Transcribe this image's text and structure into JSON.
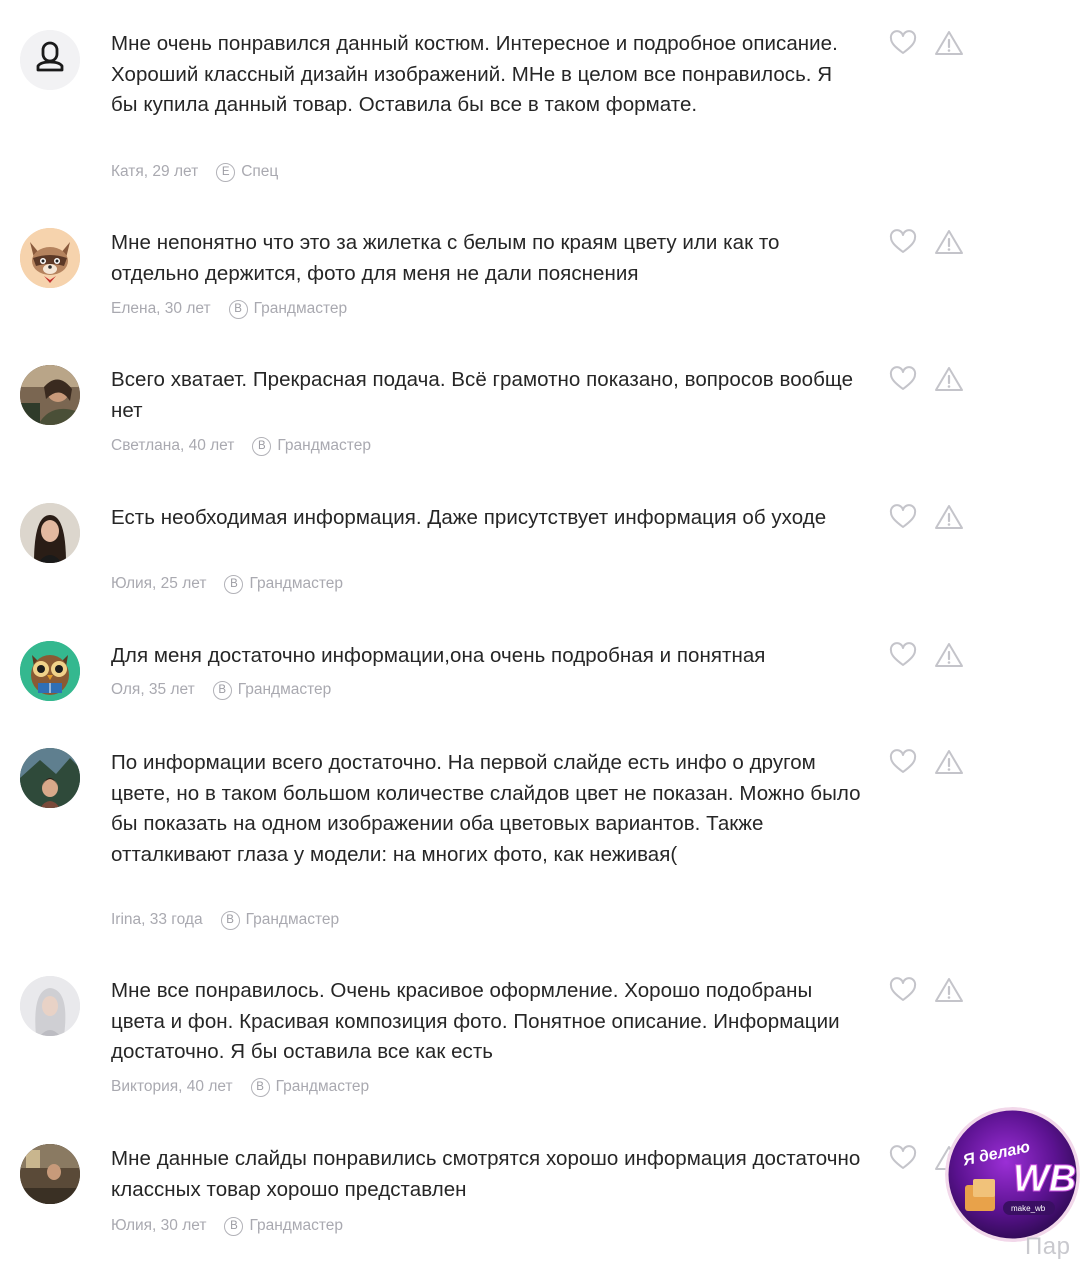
{
  "reviews": [
    {
      "text": "Мне очень понравился данный костюм. Интересное и подробное описание. Хороший классный дизайн изображений. МНе в целом все понравилось. Я бы купила данный товар. Оставила бы все в таком формате.",
      "author": "Катя, 29 лет",
      "level_letter": "E",
      "level": "Спец",
      "avatar_icon": "default-user-icon"
    },
    {
      "text": "Мне непонятно что это за жилетка с белым по краям цвету или как то отдельно держится, фото для меня не дали пояснения",
      "author": "Елена, 30 лет",
      "level_letter": "B",
      "level": "Грандмастер",
      "avatar_icon": "raccoon-avatar"
    },
    {
      "text": "Всего хватает. Прекрасная подача. Всё грамотно показано, вопросов вообще нет",
      "author": "Светлана, 40 лет",
      "level_letter": "B",
      "level": "Грандмастер",
      "avatar_icon": "photo-avatar"
    },
    {
      "text": "Есть необходимая информация. Даже присутствует информация об уходе",
      "author": "Юлия, 25 лет",
      "level_letter": "B",
      "level": "Грандмастер",
      "avatar_icon": "photo-avatar"
    },
    {
      "text": "Для меня достаточно информации,она очень подробная и понятная",
      "author": "Оля, 35 лет",
      "level_letter": "B",
      "level": "Грандмастер",
      "avatar_icon": "owl-avatar"
    },
    {
      "text": "По информации всего достаточно. На первой слайде есть инфо о другом цвете, но в таком большом количестве слайдов цвет не показан. Можно было бы показать на одном изображении оба цветовых вариантов. Также отталкивают глаза у модели: на многих фото, как неживая(",
      "author": "Irina, 33 года",
      "level_letter": "B",
      "level": "Грандмастер",
      "avatar_icon": "photo-avatar"
    },
    {
      "text": "Мне все понравилось. Очень красивое оформление. Хорошо подобраны цвета и фон. Красивая композиция фото. Понятное описание. Информации достаточно. Я бы оставила все как есть",
      "author": "Виктория, 40 лет",
      "level_letter": "B",
      "level": "Грандмастер",
      "avatar_icon": "photo-avatar"
    },
    {
      "text": "Мне данные слайды понравились смотрятся хорошо информация достаточно классных товар хорошо представлен",
      "author": "Юлия, 30 лет",
      "level_letter": "B",
      "level": "Грандмастер",
      "avatar_icon": "photo-avatar"
    }
  ],
  "actions": {
    "like_icon": "heart-icon",
    "report_icon": "warning-icon"
  },
  "watermark": {
    "line1": "Я делаю",
    "line2": "WB",
    "handle": "make_wb"
  },
  "partial_text": "Пар",
  "colors": {
    "text": "#262626",
    "meta": "#a9a9b0",
    "icon": "#c4c4ca",
    "accent": "#cb11ab"
  }
}
